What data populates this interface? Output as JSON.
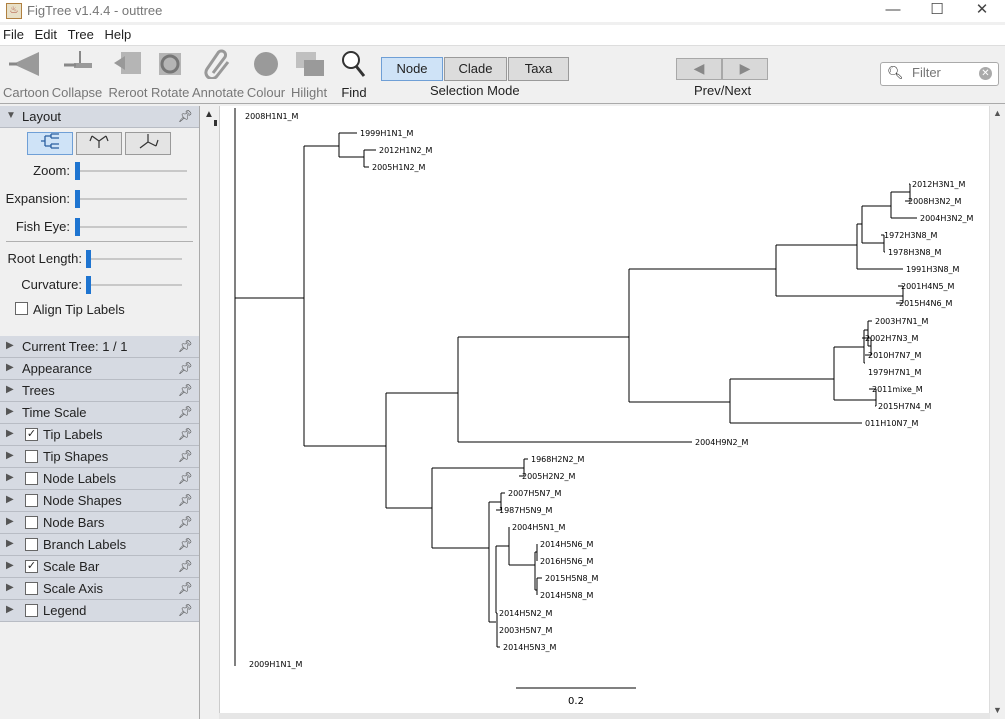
{
  "window": {
    "title": "FigTree v1.4.4 - outtree",
    "minimize": "—",
    "maximize": "☐",
    "close": "✕"
  },
  "menu": [
    "File",
    "Edit",
    "Tree",
    "Help"
  ],
  "toolbar": {
    "tools": [
      "Cartoon",
      "Collapse",
      "Reroot",
      "Rotate",
      "Annotate",
      "Colour",
      "Hilight",
      "Find"
    ],
    "selection_modes": [
      "Node",
      "Clade",
      "Taxa"
    ],
    "selected_mode": "Node",
    "selection_mode_label": "Selection Mode",
    "prev_next_label": "Prev/Next",
    "prev_arrow": "◀",
    "next_arrow": "▶",
    "filter_placeholder": "Filter"
  },
  "panel": {
    "layout": {
      "title": "Layout",
      "sliders": [
        {
          "label": "Zoom:",
          "value": 0
        },
        {
          "label": "Expansion:",
          "value": 0
        },
        {
          "label": "Fish Eye:",
          "value": 0
        },
        {
          "label": "Root Length:",
          "value": 0
        },
        {
          "label": "Curvature:",
          "value": 0
        }
      ],
      "align_tip_labels": {
        "label": "Align Tip Labels",
        "checked": false
      }
    },
    "sections": [
      {
        "label": "Current Tree: 1 / 1",
        "checkbox": null
      },
      {
        "label": "Appearance",
        "checkbox": null
      },
      {
        "label": "Trees",
        "checkbox": null
      },
      {
        "label": "Time Scale",
        "checkbox": null
      },
      {
        "label": "Tip Labels",
        "checkbox": true
      },
      {
        "label": "Tip Shapes",
        "checkbox": false
      },
      {
        "label": "Node Labels",
        "checkbox": false
      },
      {
        "label": "Node Shapes",
        "checkbox": false
      },
      {
        "label": "Node Bars",
        "checkbox": false
      },
      {
        "label": "Branch Labels",
        "checkbox": false
      },
      {
        "label": "Scale Bar",
        "checkbox": true
      },
      {
        "label": "Scale Axis",
        "checkbox": false
      },
      {
        "label": "Legend",
        "checkbox": false
      }
    ]
  },
  "tree": {
    "tip_labels": [
      "2008H1N1_M",
      "1999H1N1_M",
      "2012H1N2_M",
      "2005H1N2_M",
      "2012H3N1_M",
      "2008H3N2_M",
      "2004H3N2_M",
      "1972H3N8_M",
      "1978H3N8_M",
      "1991H3N8_M",
      "2001H4N5_M",
      "2015H4N6_M",
      "2003H7N1_M",
      "2002H7N3_M",
      "2010H7N7_M",
      "1979H7N1_M",
      "2011mixe_M",
      "2015H7N4_M",
      "011H10N7_M",
      "2004H9N2_M",
      "1968H2N2_M",
      "2005H2N2_M",
      "2007H5N7_M",
      "1987H5N9_M",
      "2004H5N1_M",
      "2014H5N6_M",
      "2016H5N6_M",
      "2015H5N8_M",
      "2014H5N8_M",
      "2014H5N2_M",
      "2003H5N7_M",
      "2014H5N3_M",
      "2009H1N1_M"
    ],
    "scale_bar_label": "0.2"
  }
}
